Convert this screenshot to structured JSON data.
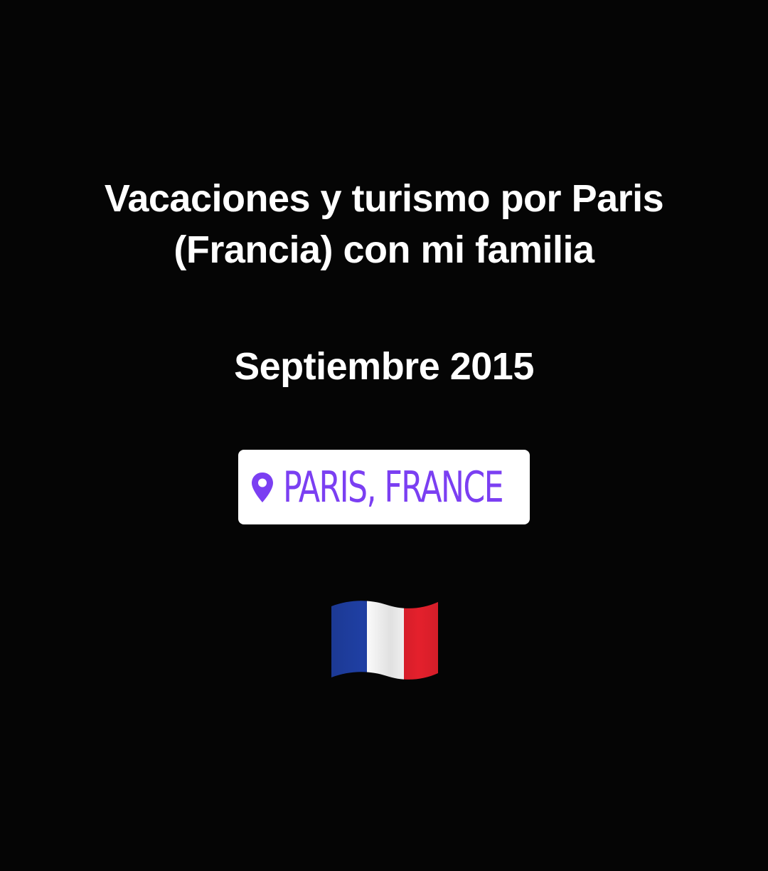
{
  "story": {
    "caption_line_1": "Vacaciones y turismo por Paris",
    "caption_line_2": "(Francia) con mi familia",
    "date": "Septiembre 2015"
  },
  "location_sticker": {
    "icon": "location-pin-icon",
    "label": "PARIS, FRANCE",
    "text_color": "#7b3ff2",
    "background": "#ffffff"
  },
  "flag": {
    "icon": "france-flag-icon",
    "colors": [
      "#1f3fa3",
      "#ffffff",
      "#e4202c"
    ]
  },
  "background_color": "#050505"
}
